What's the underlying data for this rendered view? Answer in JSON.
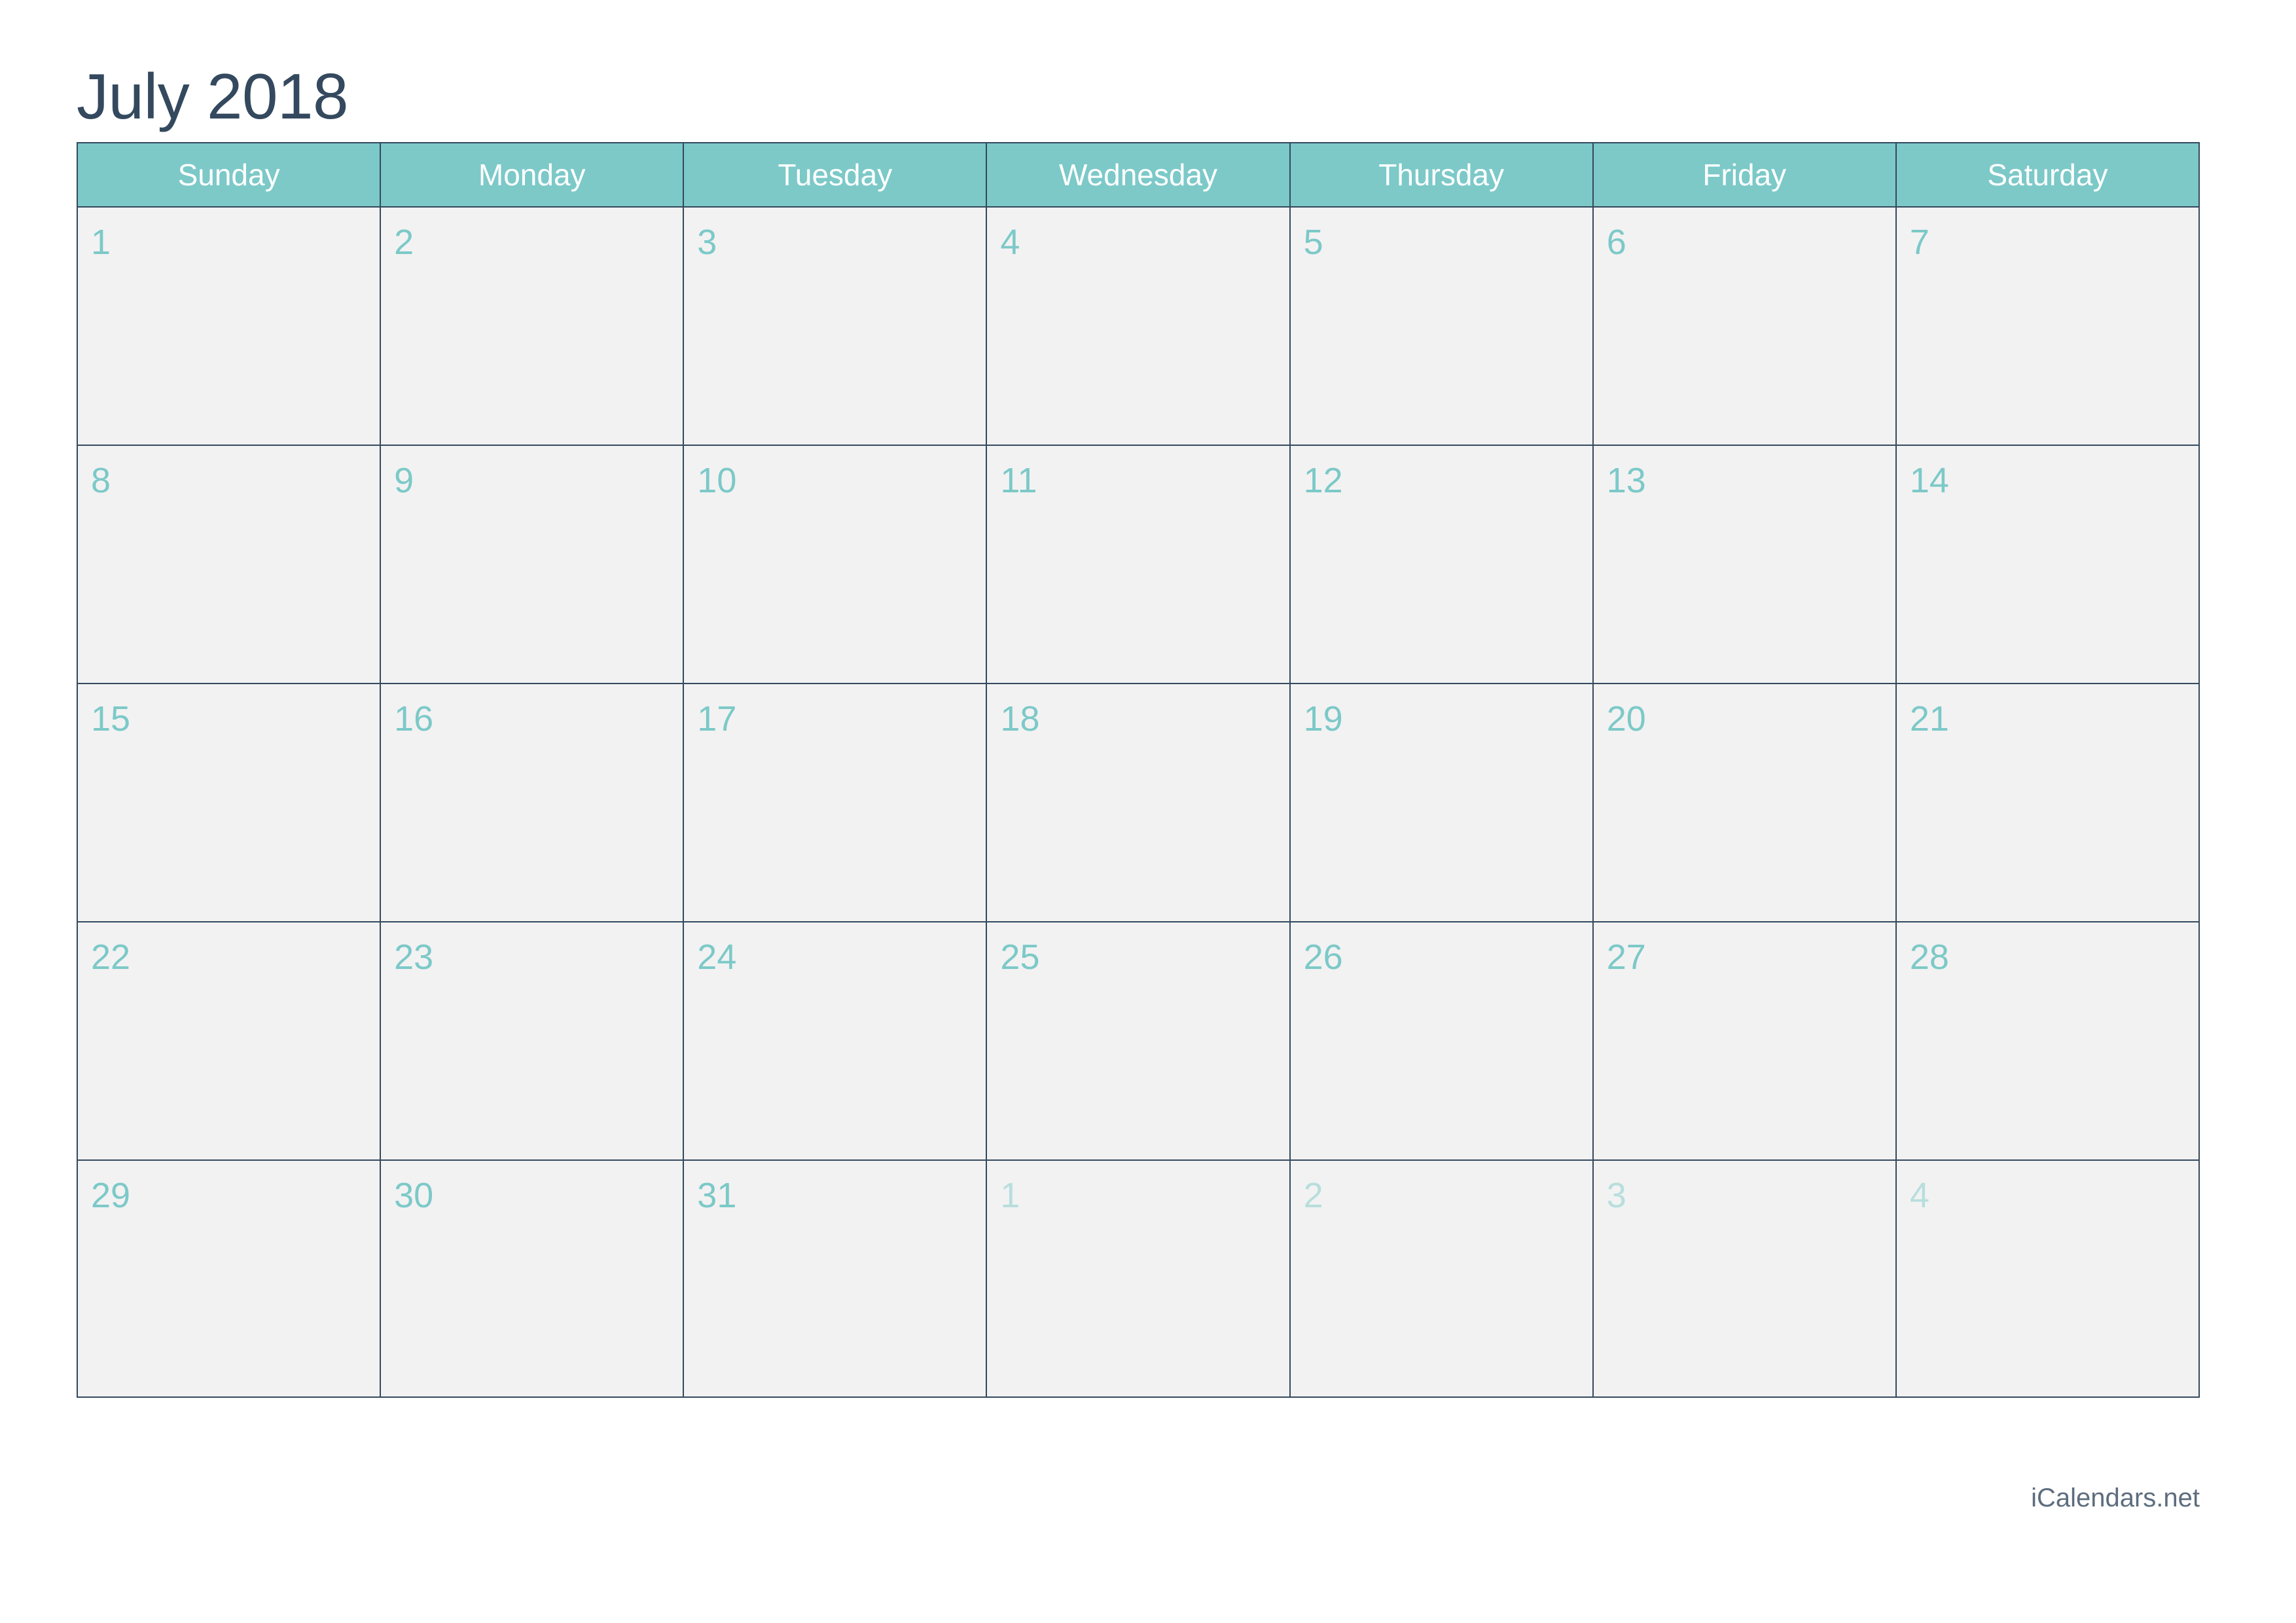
{
  "title": "July 2018",
  "weekday_headers": [
    "Sunday",
    "Monday",
    "Tuesday",
    "Wednesday",
    "Thursday",
    "Friday",
    "Saturday"
  ],
  "colors": {
    "header_background": "#7cc9c8",
    "header_text": "#ffffff",
    "title_text": "#34495e",
    "grid_line": "#34495e",
    "cell_background": "#f2f2f2",
    "other_month_background": "#e3e3e3",
    "day_number": "#7cc9c8",
    "other_month_day_number": "#b8dedd",
    "footer_text": "#5d6d7e"
  },
  "weeks": [
    [
      {
        "day": "1",
        "other_month": false
      },
      {
        "day": "2",
        "other_month": false
      },
      {
        "day": "3",
        "other_month": false
      },
      {
        "day": "4",
        "other_month": false
      },
      {
        "day": "5",
        "other_month": false
      },
      {
        "day": "6",
        "other_month": false
      },
      {
        "day": "7",
        "other_month": false
      }
    ],
    [
      {
        "day": "8",
        "other_month": false
      },
      {
        "day": "9",
        "other_month": false
      },
      {
        "day": "10",
        "other_month": false
      },
      {
        "day": "11",
        "other_month": false
      },
      {
        "day": "12",
        "other_month": false
      },
      {
        "day": "13",
        "other_month": false
      },
      {
        "day": "14",
        "other_month": false
      }
    ],
    [
      {
        "day": "15",
        "other_month": false
      },
      {
        "day": "16",
        "other_month": false
      },
      {
        "day": "17",
        "other_month": false
      },
      {
        "day": "18",
        "other_month": false
      },
      {
        "day": "19",
        "other_month": false
      },
      {
        "day": "20",
        "other_month": false
      },
      {
        "day": "21",
        "other_month": false
      }
    ],
    [
      {
        "day": "22",
        "other_month": false
      },
      {
        "day": "23",
        "other_month": false
      },
      {
        "day": "24",
        "other_month": false
      },
      {
        "day": "25",
        "other_month": false
      },
      {
        "day": "26",
        "other_month": false
      },
      {
        "day": "27",
        "other_month": false
      },
      {
        "day": "28",
        "other_month": false
      }
    ],
    [
      {
        "day": "29",
        "other_month": false
      },
      {
        "day": "30",
        "other_month": false
      },
      {
        "day": "31",
        "other_month": false
      },
      {
        "day": "1",
        "other_month": true
      },
      {
        "day": "2",
        "other_month": true
      },
      {
        "day": "3",
        "other_month": true
      },
      {
        "day": "4",
        "other_month": true
      }
    ]
  ],
  "footer": {
    "branding": "iCalendars.net"
  }
}
